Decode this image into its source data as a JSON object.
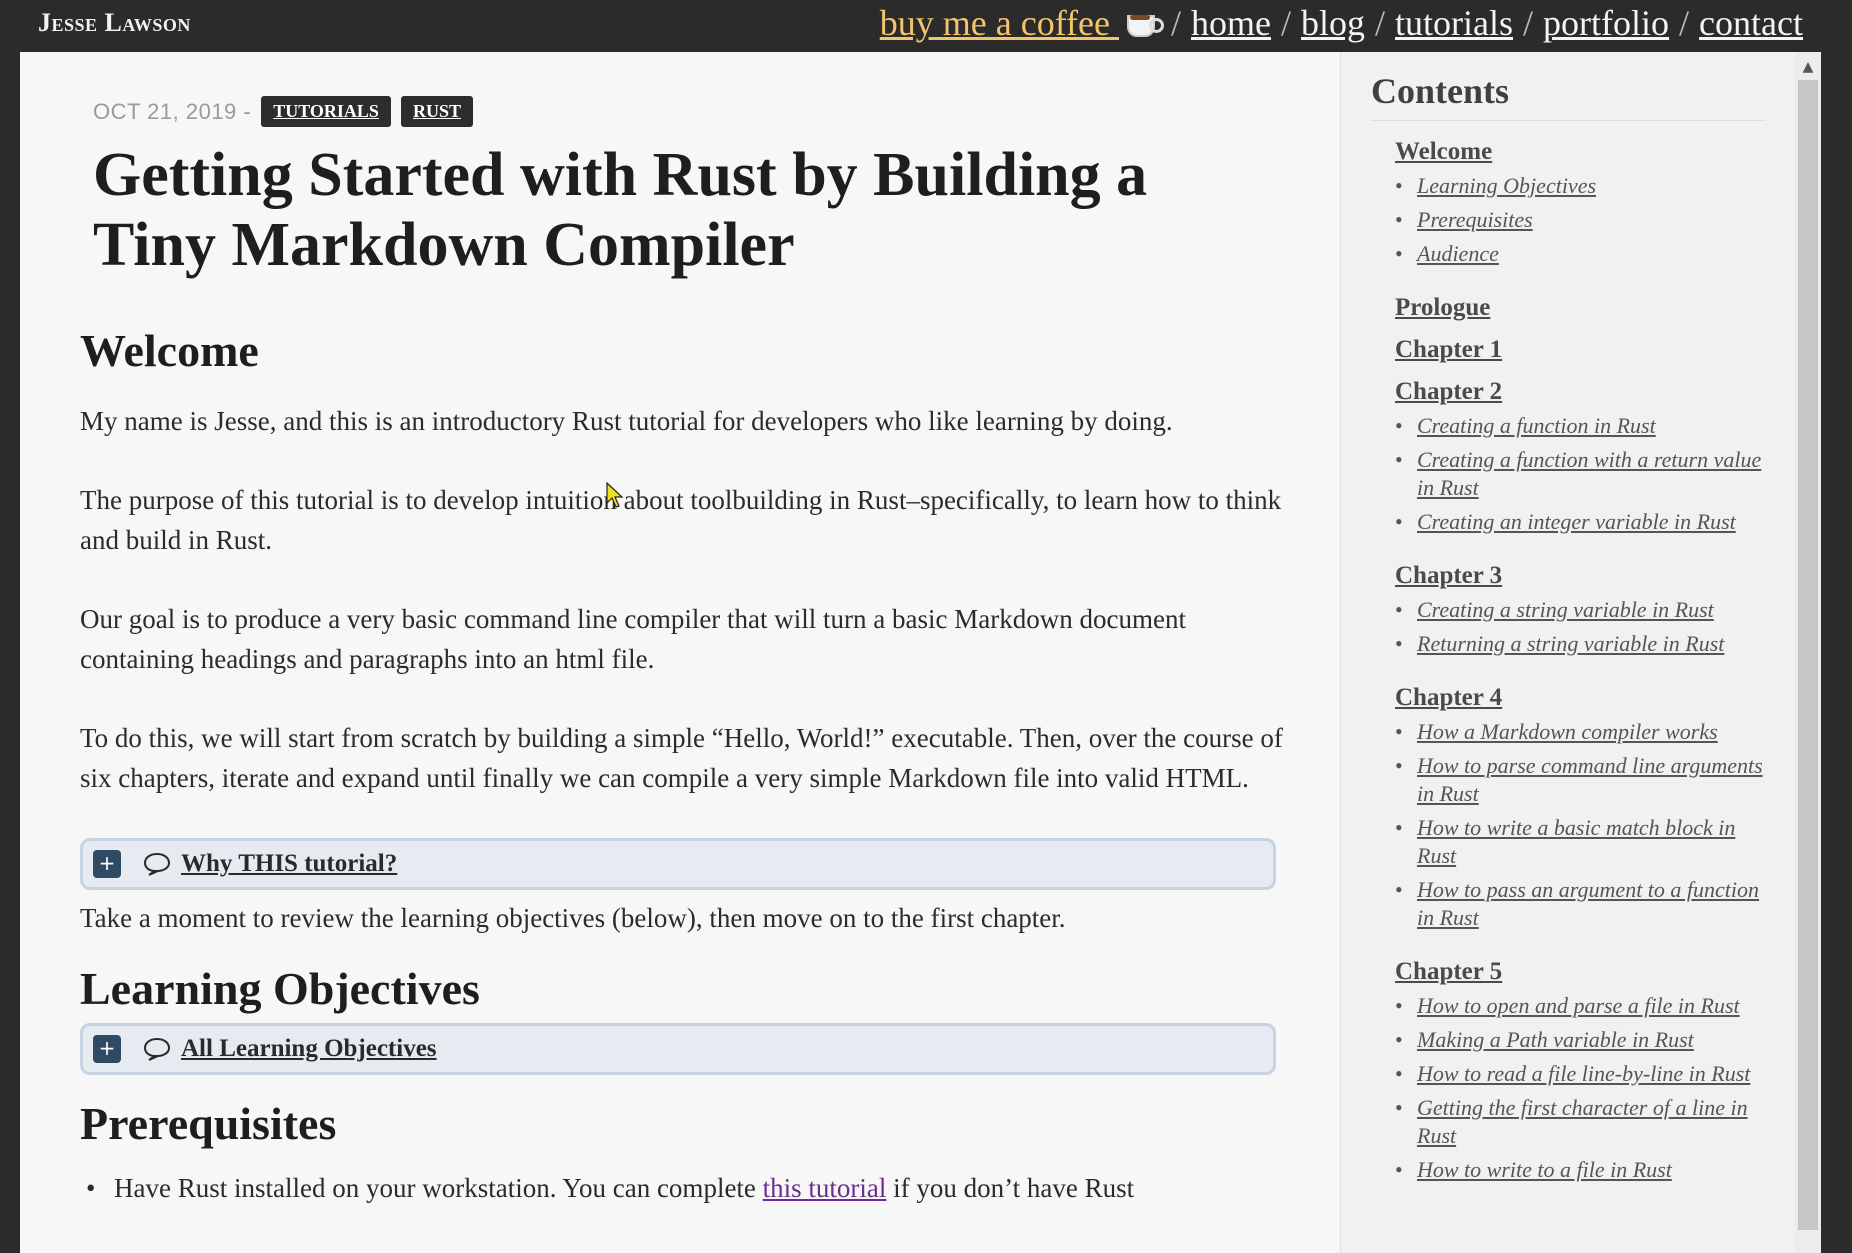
{
  "header": {
    "brand": "Jesse Lawson",
    "nav": [
      {
        "label": "buy me a coffee ",
        "icon": "coffee-cup-icon"
      },
      {
        "label": "home"
      },
      {
        "label": "blog"
      },
      {
        "label": "tutorials"
      },
      {
        "label": "portfolio"
      },
      {
        "label": "contact"
      }
    ],
    "separator": "/"
  },
  "post": {
    "date": "OCT 21, 2019 -",
    "tags": [
      "TUTORIALS",
      "RUST"
    ],
    "title": "Getting Started with Rust by Building a Tiny Markdown Compiler"
  },
  "content": {
    "welcome_heading": "Welcome",
    "paragraphs": [
      "My name is Jesse, and this is an introductory Rust tutorial for developers who like learning by doing.",
      "The purpose of this tutorial is to develop intuition about toolbuilding in Rust–specifically, to learn how to think and build in Rust.",
      "Our goal is to produce a very basic command line compiler that will turn a basic Markdown document containing headings and paragraphs into an html file.",
      "To do this, we will start from scratch by building a simple “Hello, World!” executable. Then, over the course of six chapters, iterate and expand until finally we can compile a very simple Markdown file into valid HTML."
    ],
    "collapse_why": "Why THIS tutorial?",
    "review_text": "Take a moment to review the learning objectives (below), then move on to the first chapter.",
    "objectives_heading": "Learning Objectives",
    "collapse_objectives": "All Learning Objectives",
    "prereq_heading": "Prerequisites",
    "prereq_item_pre": "Have Rust installed on your workstation. You can complete ",
    "prereq_item_link": "this tutorial",
    "prereq_item_post": " if you don’t have Rust"
  },
  "toc": {
    "title": "Contents",
    "sections": [
      {
        "head": "Welcome",
        "items": [
          "Learning Objectives",
          "Prerequisites",
          "Audience"
        ]
      },
      {
        "head": "Prologue",
        "items": []
      },
      {
        "head": "Chapter 1",
        "items": []
      },
      {
        "head": "Chapter 2",
        "items": [
          "Creating a function in Rust",
          "Creating a function with a return value in Rust",
          "Creating an integer variable in Rust"
        ]
      },
      {
        "head": "Chapter 3",
        "items": [
          "Creating a string variable in Rust",
          "Returning a string variable in Rust"
        ]
      },
      {
        "head": "Chapter 4",
        "items": [
          "How a Markdown compiler works",
          "How to parse command line arguments in Rust",
          "How to write a basic match block in Rust",
          "How to pass an argument to a function in Rust"
        ]
      },
      {
        "head": "Chapter 5",
        "items": [
          "How to open and parse a file in Rust",
          "Making a Path variable in Rust",
          "How to read a file line-by-line in Rust",
          "Getting the first character of a line in Rust",
          "How to write to a file in Rust"
        ]
      }
    ]
  },
  "colors": {
    "accent_coffee": "#f2c56b",
    "link_purple": "#6b2d8f",
    "collapse_bg": "#e6ebf2",
    "plus_button": "#2f4a63"
  }
}
